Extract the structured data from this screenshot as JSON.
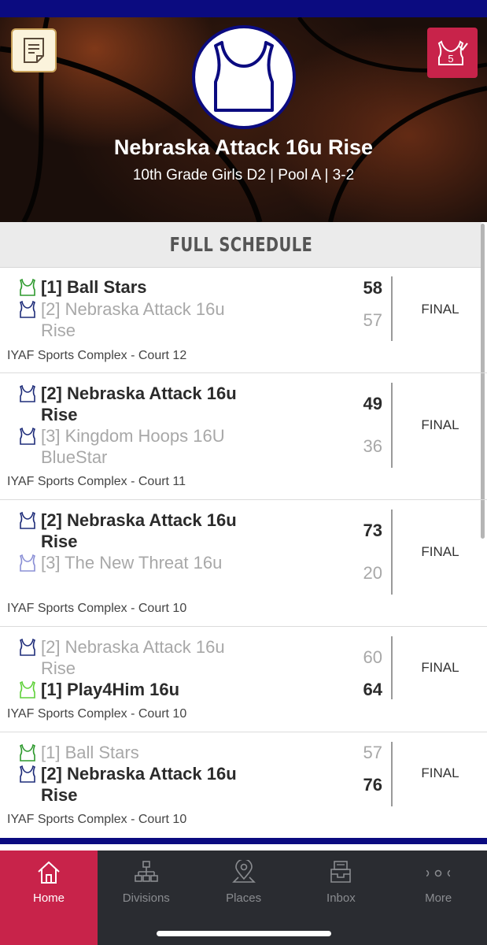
{
  "header": {
    "team_name": "Nebraska Attack 16u Rise",
    "subtitle": "10th Grade Girls D2 | Pool A | 3-2",
    "checkin_count": "5"
  },
  "section": {
    "title": "FULL SCHEDULE"
  },
  "games": [
    {
      "teams": [
        {
          "label": "[1] Ball Stars",
          "score": "58",
          "result": "win",
          "jersey": "green-jersey-icon"
        },
        {
          "label": "[2] Nebraska Attack 16u Rise",
          "score": "57",
          "result": "lose",
          "jersey": "navy-jersey-icon"
        }
      ],
      "status": "FINAL",
      "venue": "IYAF Sports Complex - Court 12"
    },
    {
      "teams": [
        {
          "label": "[2] Nebraska Attack 16u Rise",
          "score": "49",
          "result": "win",
          "jersey": "navy-jersey-icon"
        },
        {
          "label": "[3] Kingdom Hoops 16U BlueStar",
          "score": "36",
          "result": "lose",
          "jersey": "navy-jersey-icon"
        }
      ],
      "status": "FINAL",
      "venue": "IYAF Sports Complex - Court 11"
    },
    {
      "teams": [
        {
          "label": "[2] Nebraska Attack 16u Rise",
          "score": "73",
          "result": "win",
          "jersey": "navy-jersey-icon"
        },
        {
          "label": "[3] The New Threat 16u",
          "score": "20",
          "result": "lose",
          "jersey": "lavender-jersey-icon"
        }
      ],
      "status": "FINAL",
      "venue": "IYAF Sports Complex - Court 10"
    },
    {
      "teams": [
        {
          "label": "[2] Nebraska Attack 16u Rise",
          "score": "60",
          "result": "lose",
          "jersey": "navy-jersey-icon"
        },
        {
          "label": "[1] Play4Him 16u",
          "score": "64",
          "result": "win",
          "jersey": "lime-jersey-icon"
        }
      ],
      "status": "FINAL",
      "venue": "IYAF Sports Complex - Court 10"
    },
    {
      "teams": [
        {
          "label": "[1] Ball Stars",
          "score": "57",
          "result": "lose",
          "jersey": "green-jersey-icon"
        },
        {
          "label": "[2] Nebraska Attack 16u Rise",
          "score": "76",
          "result": "win",
          "jersey": "navy-jersey-icon"
        }
      ],
      "status": "FINAL",
      "venue": "IYAF Sports Complex - Court 10"
    }
  ],
  "nav": {
    "items": [
      {
        "label": "Home",
        "icon": "home-icon",
        "active": true
      },
      {
        "label": "Divisions",
        "icon": "org-chart-icon",
        "active": false
      },
      {
        "label": "Places",
        "icon": "map-pin-icon",
        "active": false
      },
      {
        "label": "Inbox",
        "icon": "inbox-icon",
        "active": false
      },
      {
        "label": "More",
        "icon": "more-dots-icon",
        "active": false
      }
    ]
  },
  "colors": {
    "brand_navy": "#0b0b80",
    "accent_red": "#c8234a",
    "nav_background": "#2a2c31",
    "jersey_green": "#2e9a2e",
    "jersey_lime": "#5fd13a",
    "jersey_navy": "#1f2d7a",
    "jersey_lavender": "#8b90d6"
  }
}
